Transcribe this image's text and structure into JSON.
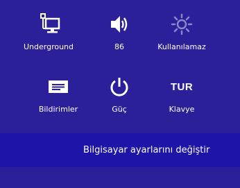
{
  "settings_tiles": [
    {
      "label": "Underground",
      "icon": "network-icon"
    },
    {
      "label": "86",
      "icon": "volume-icon"
    },
    {
      "label": "Kullanılamaz",
      "icon": "brightness-icon"
    },
    {
      "label": "Bildirimler",
      "icon": "notifications-icon"
    },
    {
      "label": "Güç",
      "icon": "power-icon"
    },
    {
      "label": "Klavye",
      "icon_text": "TUR"
    }
  ],
  "footer": {
    "change_settings_label": "Bilgisayar ayarlarını değiştir"
  },
  "colors": {
    "background": "#2b1f9a",
    "footer_bar": "#1f14a8",
    "brightness_icon": "#8888cc",
    "text": "#ffffff"
  }
}
